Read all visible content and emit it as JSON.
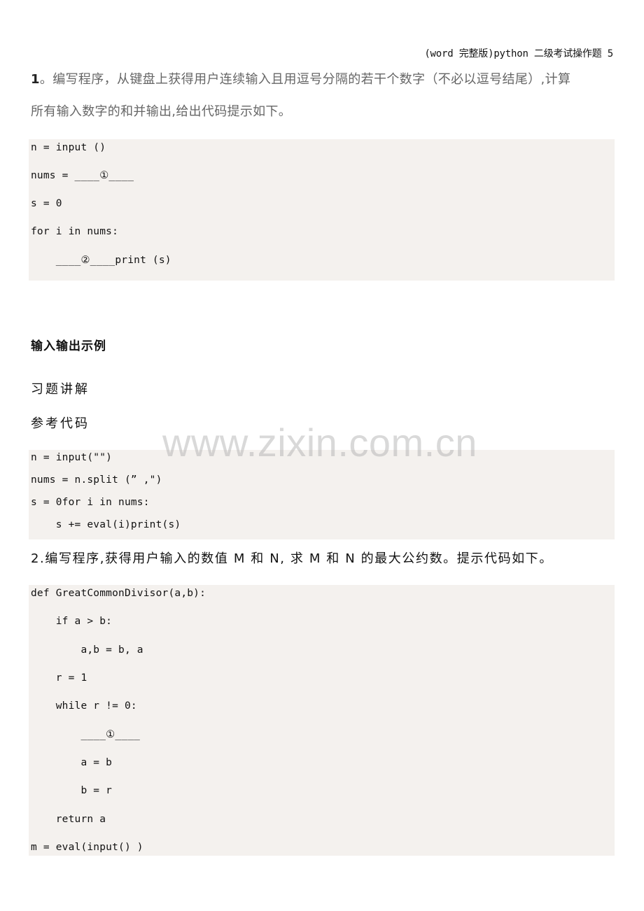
{
  "header": {
    "title": "(word 完整版)python 二级考试操作题 5"
  },
  "question1": {
    "number": "1",
    "line1_rest": "。编写程序，从键盘上获得用户连续输入且用逗号分隔的若干个数字（不必以逗号结尾）,计算",
    "line2": "所有输入数字的和并输出,给出代码提示如下。",
    "hint_code": [
      "n = input ()",
      "nums = ____①____",
      "s = 0",
      "for i in nums:",
      "    ____②____print (s)"
    ]
  },
  "io_example_heading": "输入输出示例",
  "exercise_explanation_label": "习题讲解",
  "reference_code_label": "参考代码",
  "reference_code": [
    "n = input(\"\")",
    "nums = n.split (” ,\")",
    "s = 0for i in nums:",
    "    s += eval(i)print(s)"
  ],
  "question2": {
    "text": "2.编写程序,获得用户输入的数值 M 和 N, 求 M 和 N 的最大公约数。提示代码如下。",
    "hint_code": [
      "def GreatCommonDivisor(a,b):",
      "    if a > b:",
      "        a,b = b, a",
      "    r = 1",
      "    while r != 0:",
      "        ____①____",
      "        a = b",
      "        b = r",
      "    return a",
      "m = eval(input() )"
    ]
  },
  "watermark": "www.zixin.com.cn"
}
